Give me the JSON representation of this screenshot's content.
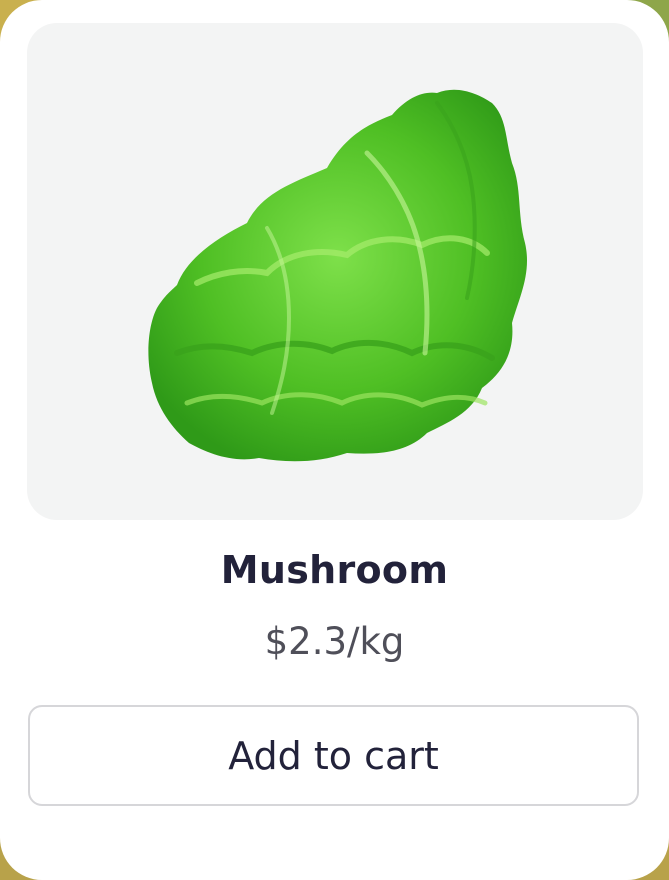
{
  "product": {
    "name": "Mushroom",
    "price": "$2.3/kg",
    "image_icon": "lettuce-icon"
  },
  "actions": {
    "add_to_cart_label": "Add to cart"
  },
  "colors": {
    "card_background": "#ffffff",
    "image_background": "#f3f4f4",
    "title_text": "#22223a",
    "price_text": "#4f4f59",
    "button_border": "#d6d6d9",
    "lettuce_green": "#5cc92b"
  }
}
